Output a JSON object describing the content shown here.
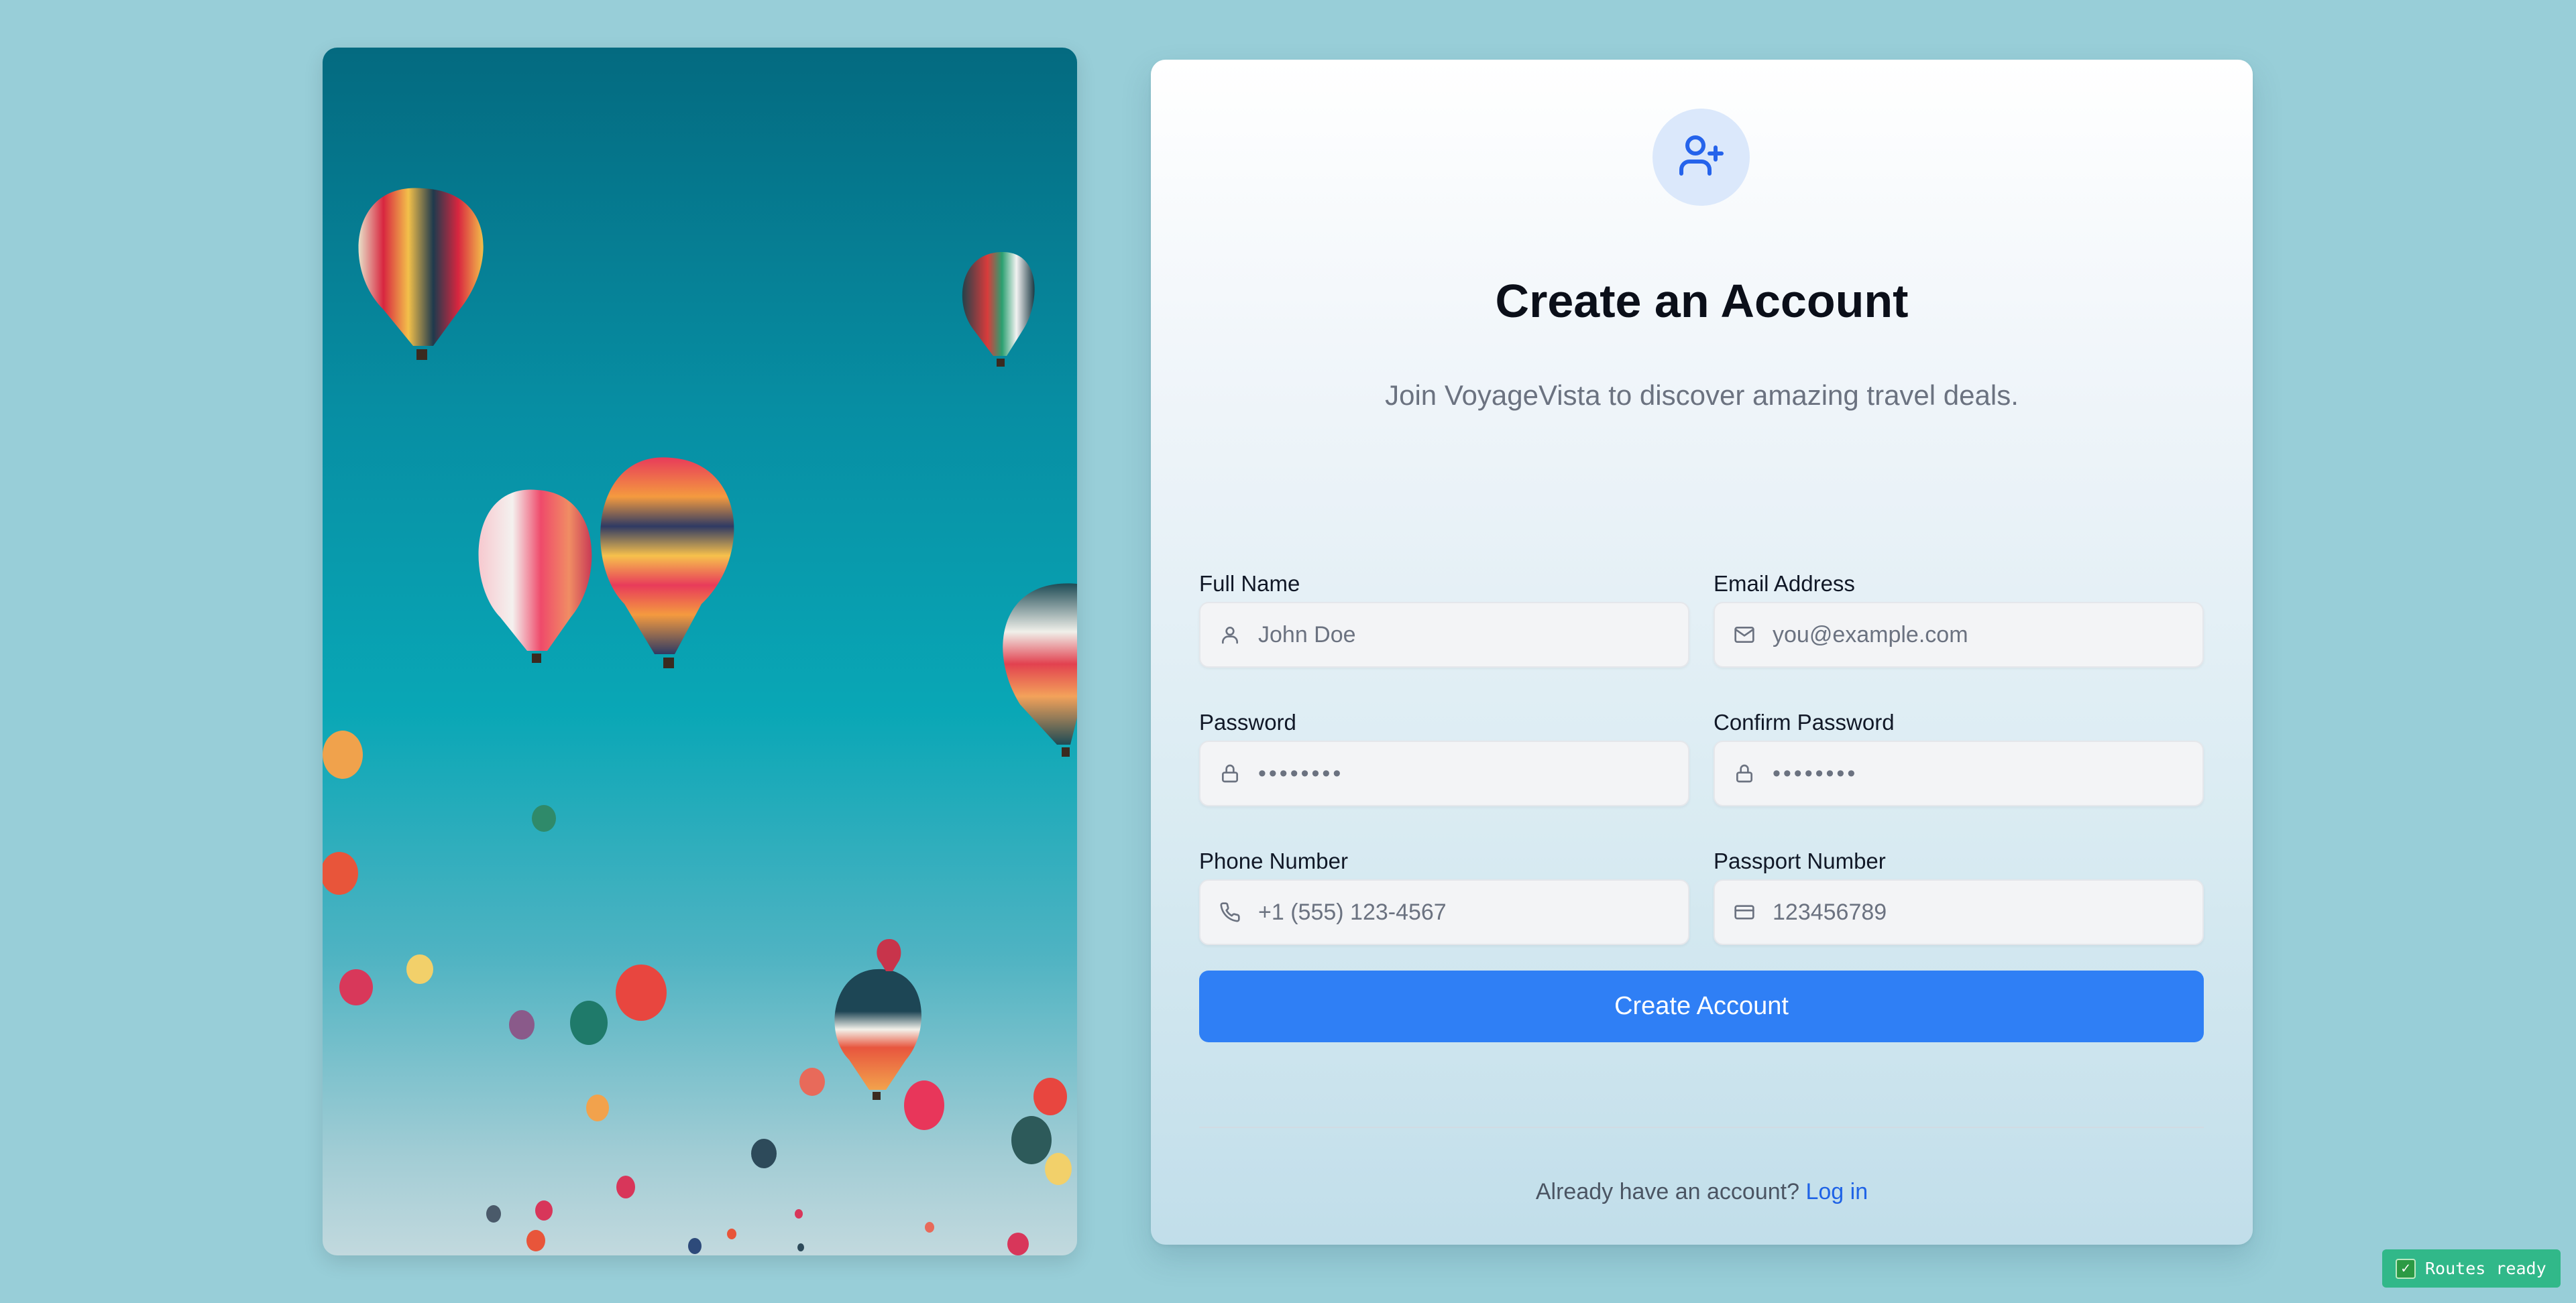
{
  "hero": {
    "image_name": "hot-air-balloons-sky"
  },
  "signup": {
    "icon": "user-plus-icon",
    "title": "Create an Account",
    "subtitle": "Join VoyageVista to discover amazing travel deals.",
    "fields": [
      {
        "label": "Full Name",
        "placeholder": "John Doe",
        "icon": "user-icon",
        "value": ""
      },
      {
        "label": "Email Address",
        "placeholder": "you@example.com",
        "icon": "mail-icon",
        "value": ""
      },
      {
        "label": "Password",
        "placeholder": "••••••••",
        "icon": "lock-icon",
        "value": ""
      },
      {
        "label": "Confirm Password",
        "placeholder": "••••••••",
        "icon": "lock-icon",
        "value": ""
      },
      {
        "label": "Phone Number",
        "placeholder": "+1 (555) 123-4567",
        "icon": "phone-icon",
        "value": ""
      },
      {
        "label": "Passport Number",
        "placeholder": "123456789",
        "icon": "id-card-icon",
        "value": ""
      }
    ],
    "submit_label": "Create Account",
    "footer_text": "Already have an account?",
    "login_link": "Log in"
  },
  "status_badge": {
    "icon": "check-icon",
    "text": "Routes ready"
  },
  "colors": {
    "background": "#98ced8",
    "primary": "#2f7ff5",
    "link": "#1f63e6",
    "status": "#31b889"
  }
}
